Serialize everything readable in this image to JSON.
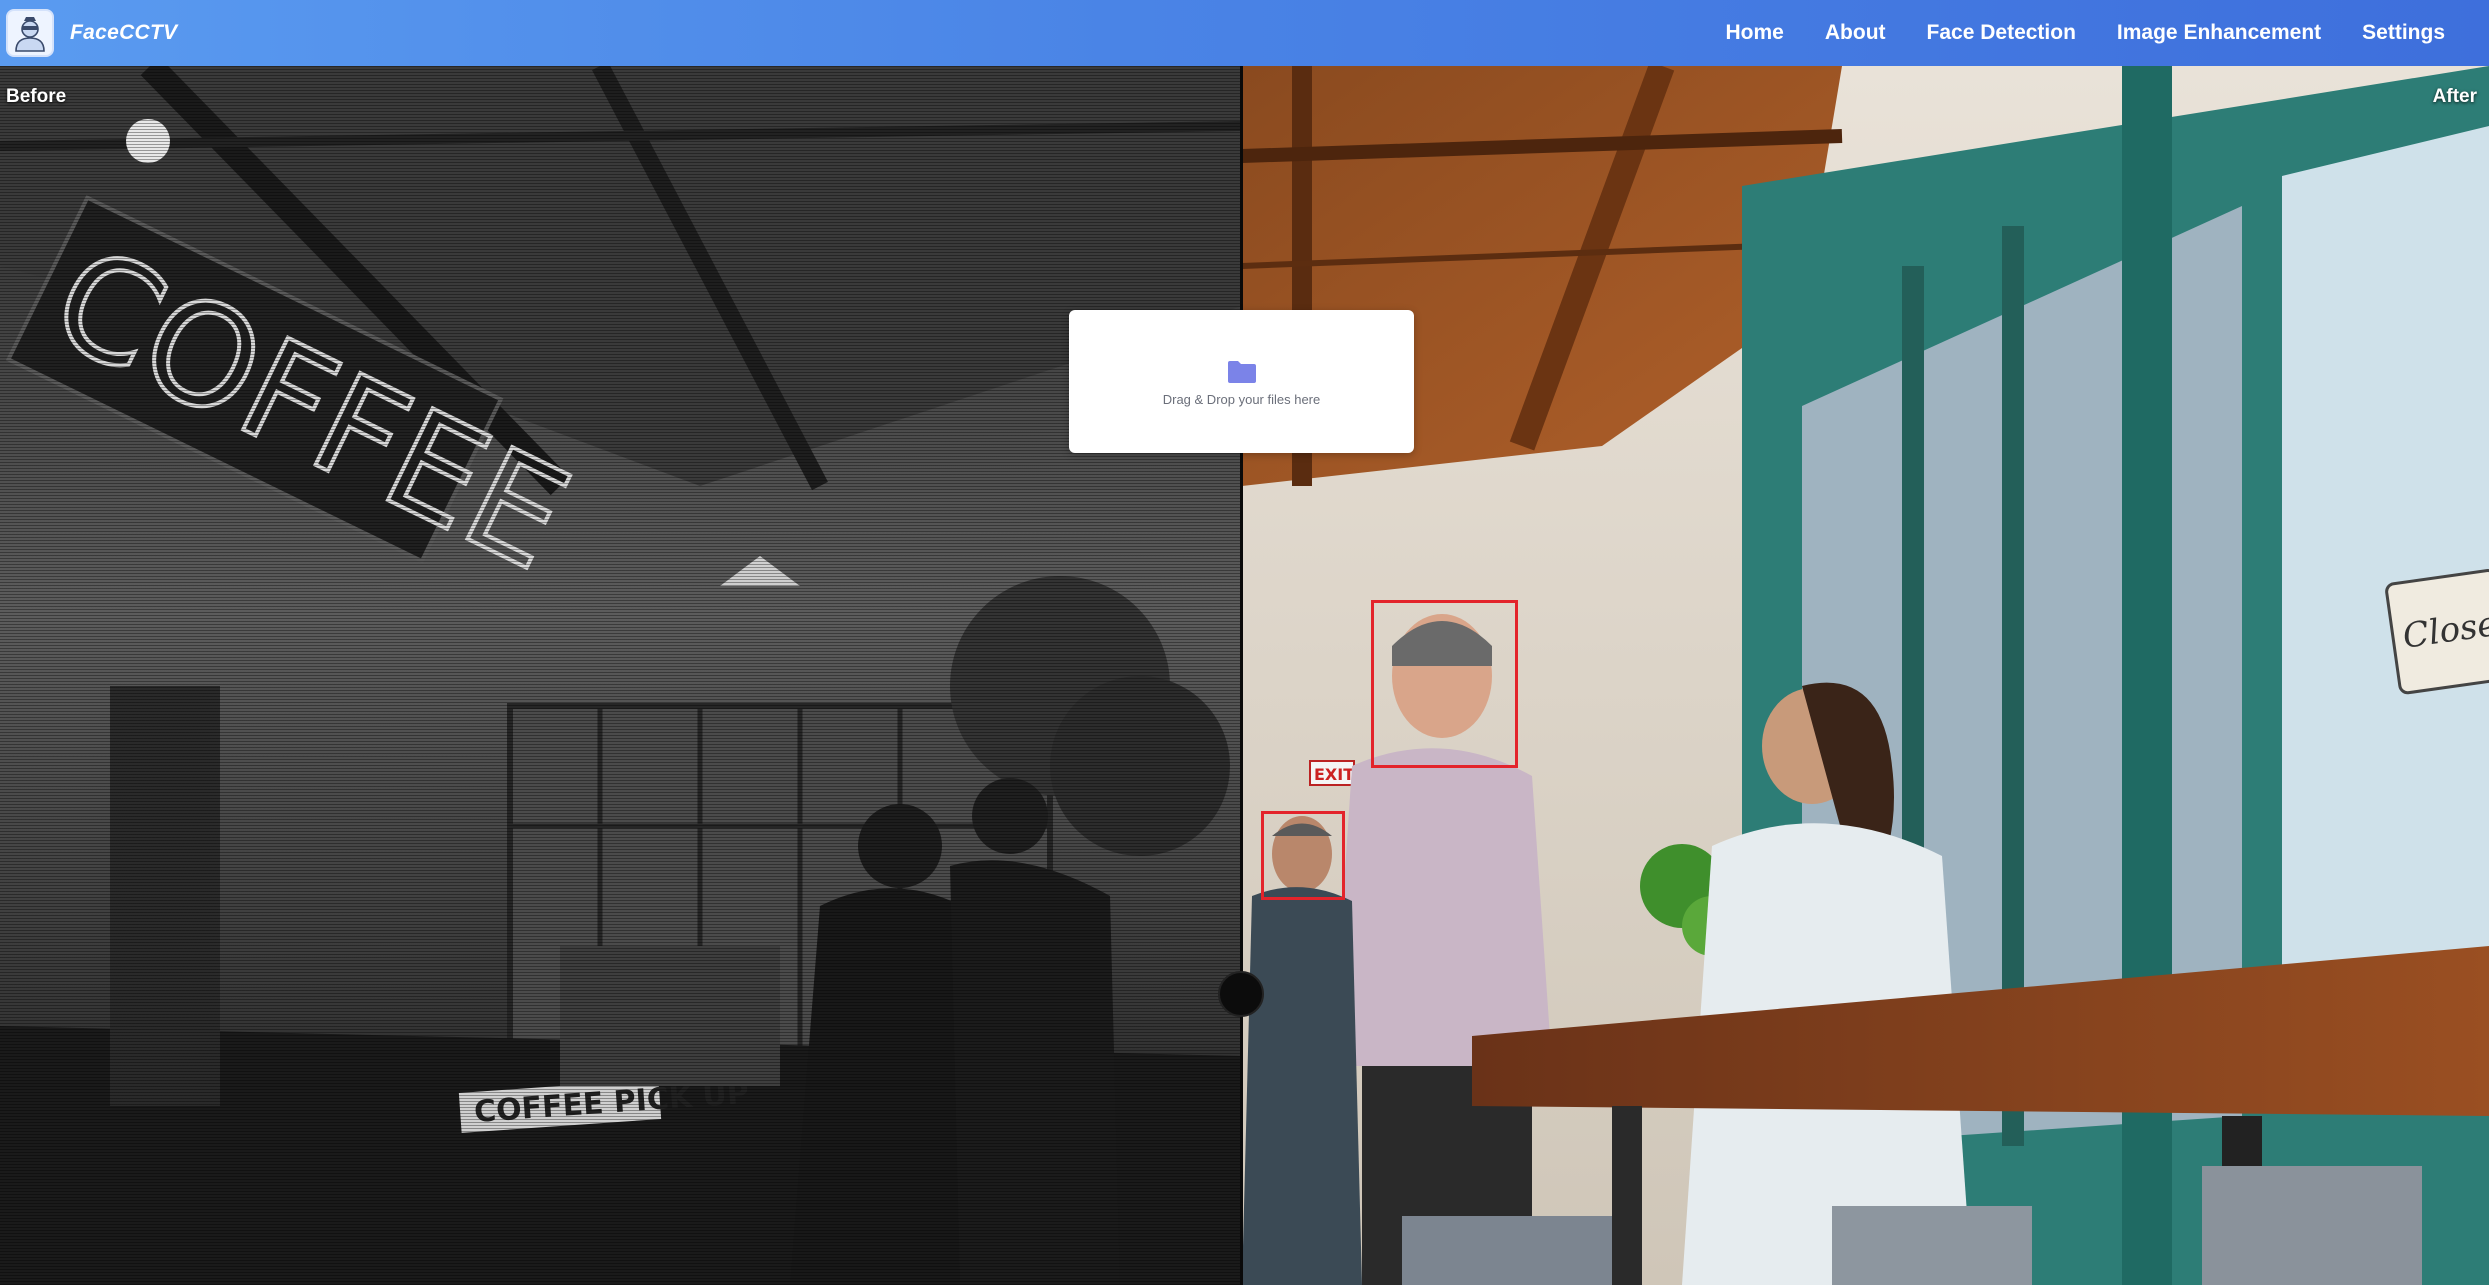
{
  "app": {
    "name": "FaceCCTV",
    "logo_icon": "cctv-person-logo-icon"
  },
  "nav": {
    "items": [
      {
        "label": "Home"
      },
      {
        "label": "About"
      },
      {
        "label": "Face Detection"
      },
      {
        "label": "Image Enhancement"
      },
      {
        "label": "Settings"
      }
    ]
  },
  "comparison": {
    "before_label": "Before",
    "after_label": "After",
    "detected_faces": 2,
    "face_box_color": "#e3242b"
  },
  "upload": {
    "icon": "folder-icon",
    "text": "Drag & Drop your files here",
    "icon_color": "#7b83e8"
  },
  "colors": {
    "nav_gradient_start": "#5a9bf0",
    "nav_gradient_end": "#3e6fdc"
  }
}
